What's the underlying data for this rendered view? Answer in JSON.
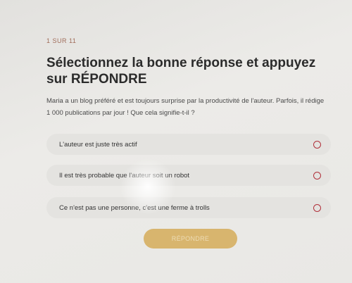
{
  "quiz": {
    "progress": "1 SUR 11",
    "title": "Sélectionnez la bonne réponse et appuyez sur RÉPONDRE",
    "description": "Maria a un blog préféré et est toujours surprise par la productivité de l'auteur. Parfois, il rédige 1 000 publications par jour ! Que cela signifie-t-il ?",
    "options": [
      {
        "label": "L'auteur est juste très actif"
      },
      {
        "label": "Il est très probable que l'auteur soit un robot"
      },
      {
        "label": "Ce n'est pas une personne, c'est une ferme à trolls"
      }
    ],
    "submit_label": "RÉPONDRE"
  },
  "colors": {
    "accent_radio": "#b0303a",
    "submit_button": "#d8b56e",
    "progress_text": "#a06d5a"
  }
}
